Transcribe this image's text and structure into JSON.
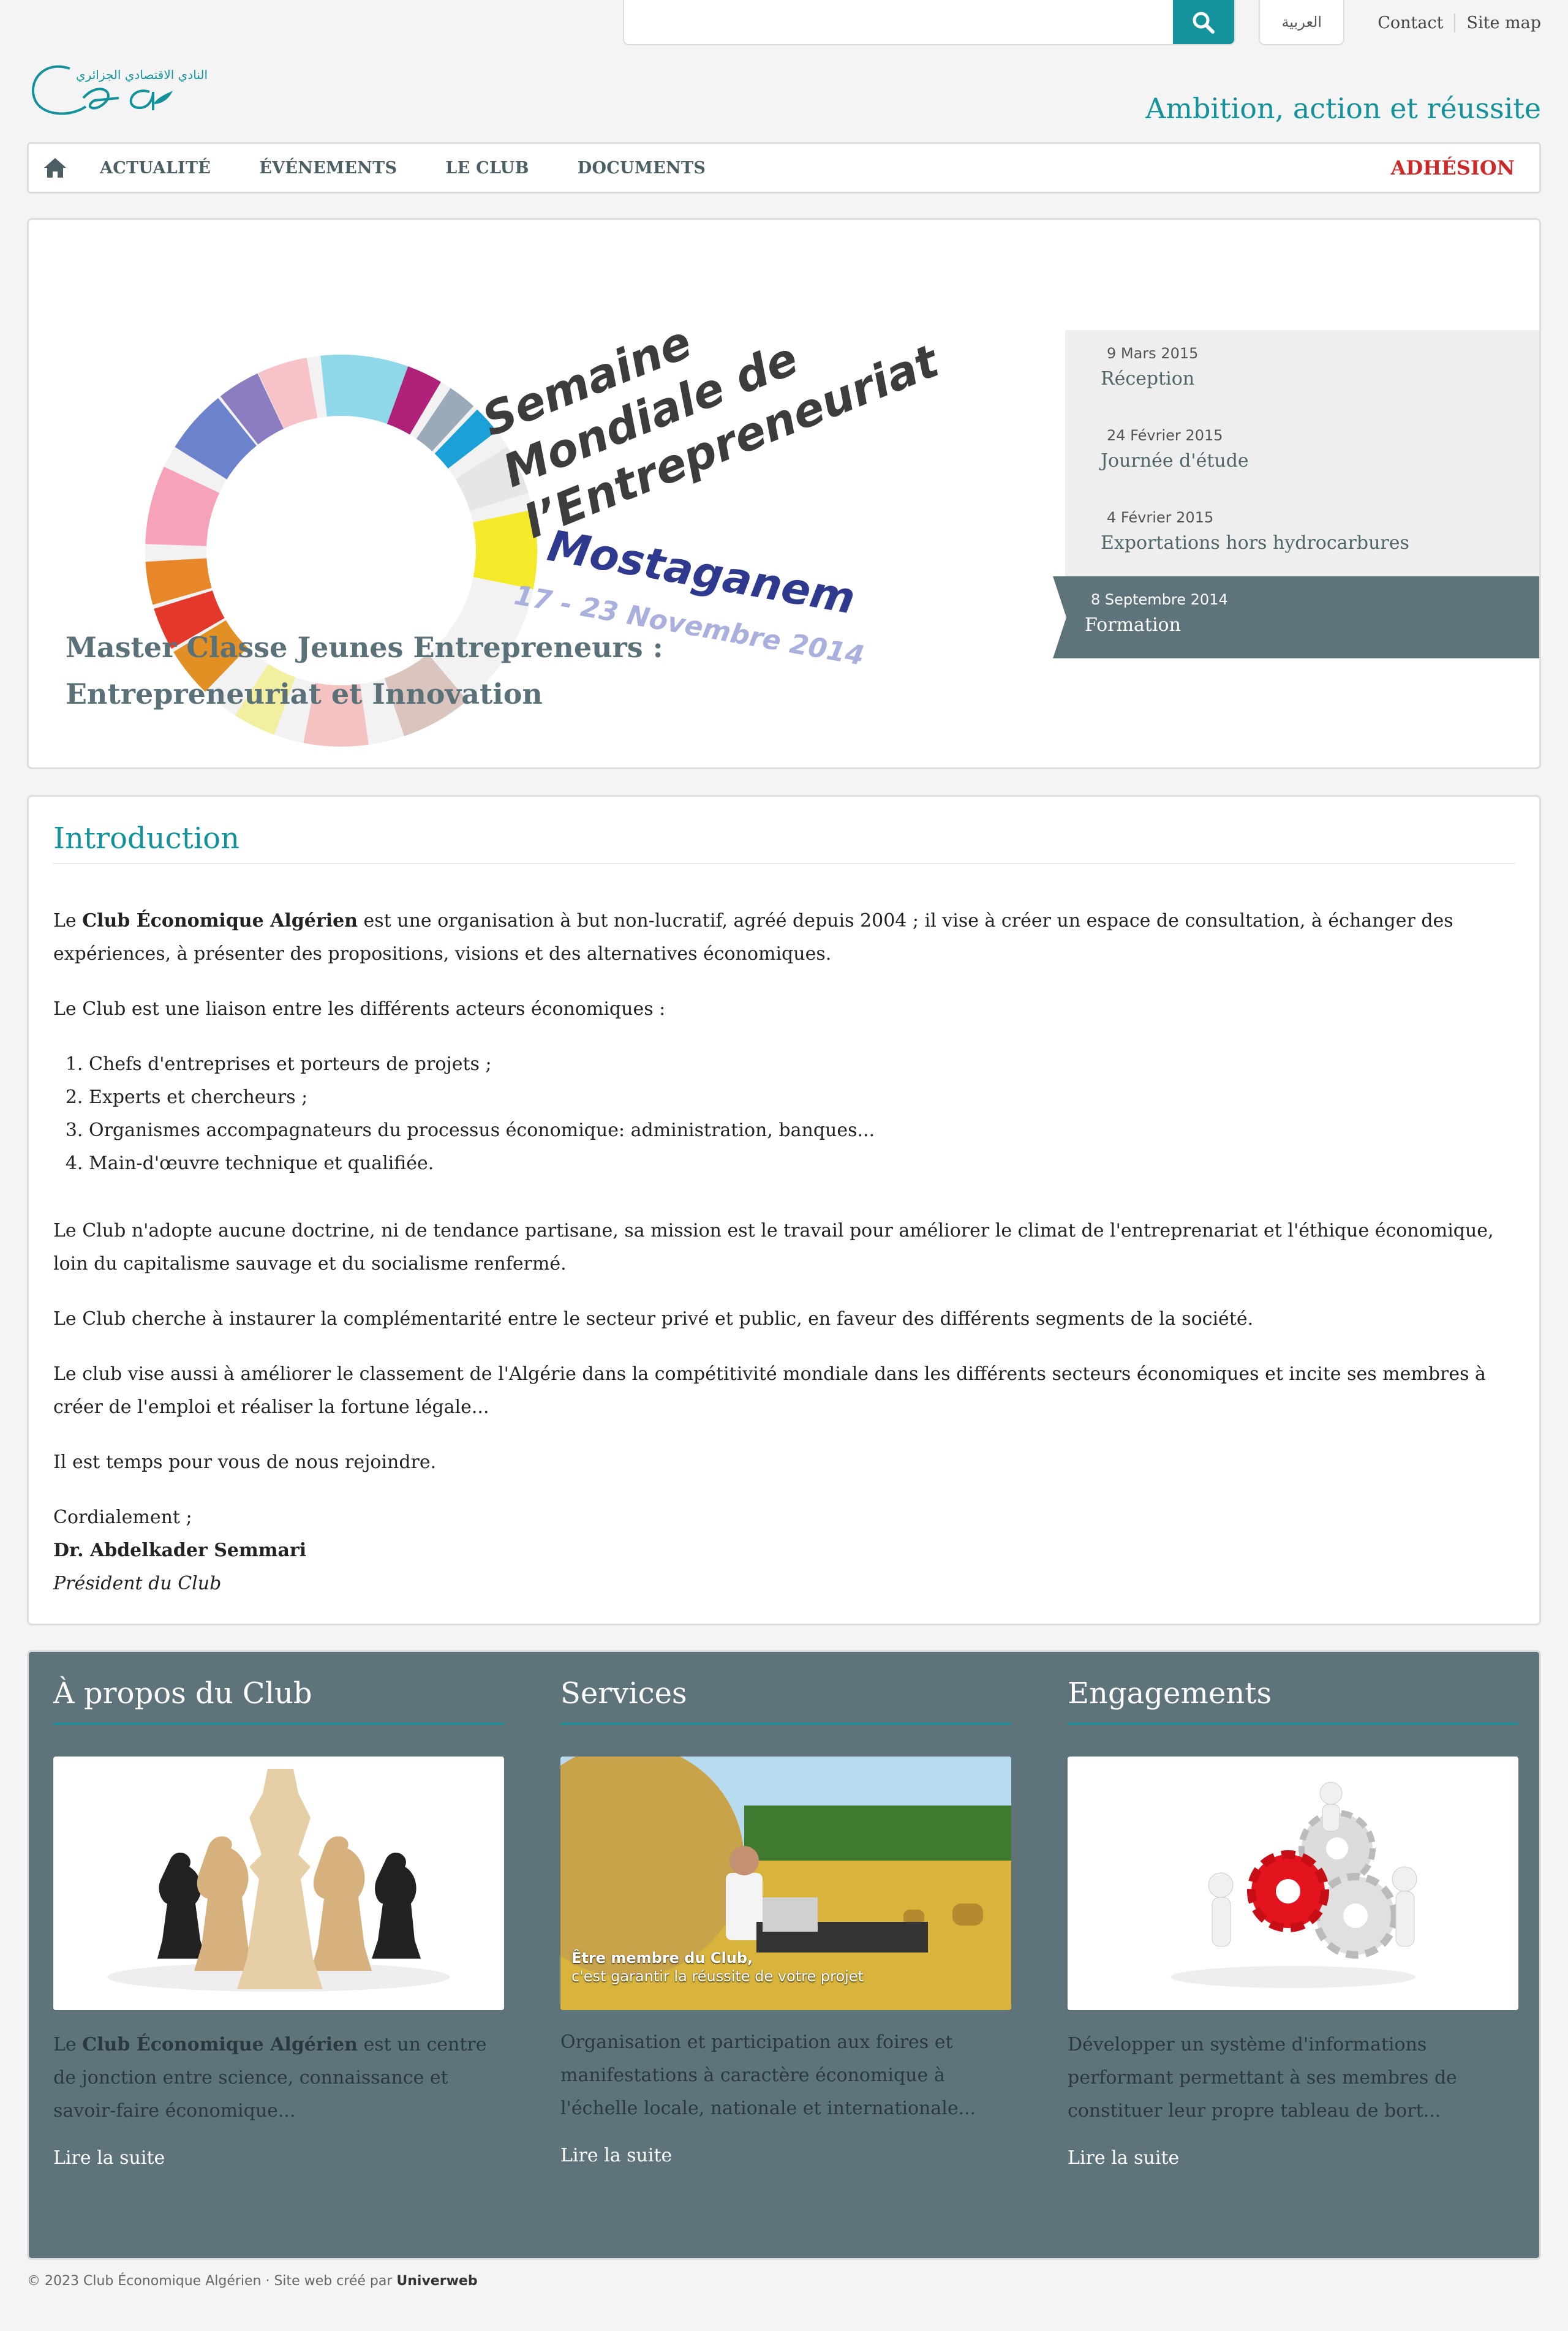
{
  "topbar": {
    "search_placeholder": "",
    "lang_label": "العربية",
    "links": [
      "Contact",
      "Site map"
    ]
  },
  "logo": {
    "text": "Cea",
    "arabic": "النادي الاقتصادي الجزائري"
  },
  "slogan": "Ambition, action et réussite",
  "nav": {
    "items": [
      "ACTUALITÉ",
      "ÉVÉNEMENTS",
      "LE CLUB",
      "DOCUMENTS"
    ],
    "cta": "ADHÉSION"
  },
  "hero": {
    "graphic_lines": [
      "Semaine",
      "Mondiale de",
      "l’Entrepreneuriat"
    ],
    "graphic_place": "Mostaganem",
    "graphic_dates": "17 - 23 Novembre 2014",
    "title": "Master Classe Jeunes Entrepreneurs : Entrepreneuriat et Innovation",
    "events": [
      {
        "date": "9 Mars 2015",
        "title": "Réception"
      },
      {
        "date": "24 Février 2015",
        "title": "Journée d'étude"
      },
      {
        "date": "4 Février 2015",
        "title": "Exportations hors hydrocarbures"
      },
      {
        "date": "8 Septembre 2014",
        "title": "Formation",
        "active": true
      }
    ]
  },
  "intro": {
    "heading": "Introduction",
    "p1_pre": "Le ",
    "p1_bold": "Club Économique Algérien",
    "p1_post": " est une organisation à but non-lucratif, agréé depuis 2004 ; il vise à créer un espace de consultation, à échanger des expériences, à présenter des propositions, visions et des alternatives économiques.",
    "p2": "Le Club est une liaison entre les différents acteurs économiques :",
    "list": [
      "Chefs d'entreprises et porteurs de projets ;",
      "Experts et chercheurs ;",
      "Organismes accompagnateurs du processus économique: administration, banques...",
      "Main-d'œuvre technique et qualifiée."
    ],
    "p3": "Le Club n'adopte aucune doctrine, ni de tendance partisane, sa mission est le travail pour améliorer le climat de l'entreprenariat et l'éthique économique, loin du capitalisme sauvage et du socialisme renfermé.",
    "p4": "Le Club cherche à instaurer la complémentarité entre le secteur privé et public, en faveur des différents segments de la société.",
    "p5": "Le club vise aussi à améliorer le classement de l'Algérie dans la compétitivité mondiale dans les différents secteurs économiques et incite ses membres à créer de l'emploi et réaliser la fortune légale...",
    "p6": "Il est temps pour vous de nous rejoindre.",
    "closing": "Cordialement ;",
    "signer": "Dr. Abdelkader Semmari",
    "role": "Président du Club"
  },
  "columns": [
    {
      "heading": "À propos du Club",
      "text_pre": "Le ",
      "text_bold": "Club Économique Algérien",
      "text_post": " est un centre de jonction entre science, connaissance et savoir-faire économique...",
      "more": "Lire la suite"
    },
    {
      "heading": "Services",
      "caption_bold": "Être membre du Club,",
      "caption": "c'est garantir la réussite de votre projet",
      "text": "Organisation et participation aux foires et manifestations à caractère économique à l'échelle locale, nationale et internationale...",
      "more": "Lire la suite"
    },
    {
      "heading": "Engagements",
      "text": "Développer un système d'informations performant permettant à ses membres de constituer leur propre tableau de bort...",
      "more": "Lire la suite"
    }
  ],
  "footer": {
    "copyright": "© 2023 Club Économique Algérien · Site web créé par ",
    "author": "Univerweb"
  },
  "colors": {
    "accent": "#14929b",
    "panel": "#5f747a",
    "cta": "#cc2a2a"
  }
}
